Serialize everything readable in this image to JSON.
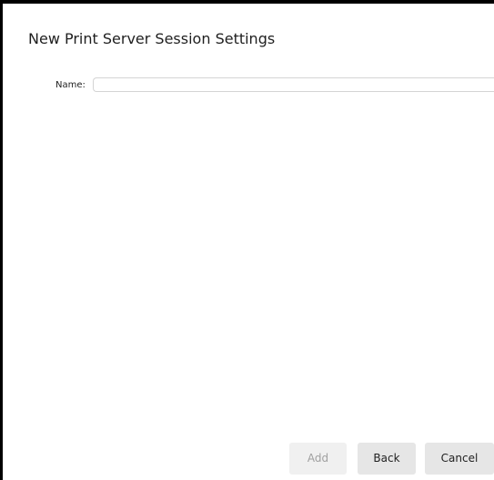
{
  "dialog": {
    "title": "New Print Server Session Settings"
  },
  "form": {
    "name_label": "Name:",
    "name_value": "",
    "name_placeholder": ""
  },
  "footer": {
    "add_label": "Add",
    "add_enabled": false,
    "back_label": "Back",
    "cancel_label": "Cancel"
  },
  "colors": {
    "frame": "#000000",
    "background": "#ffffff",
    "button_bg": "#e6e6e6",
    "button_disabled_bg": "#f0f0f0",
    "button_disabled_text": "#a0a0a0",
    "input_border": "#d4d4d4"
  }
}
